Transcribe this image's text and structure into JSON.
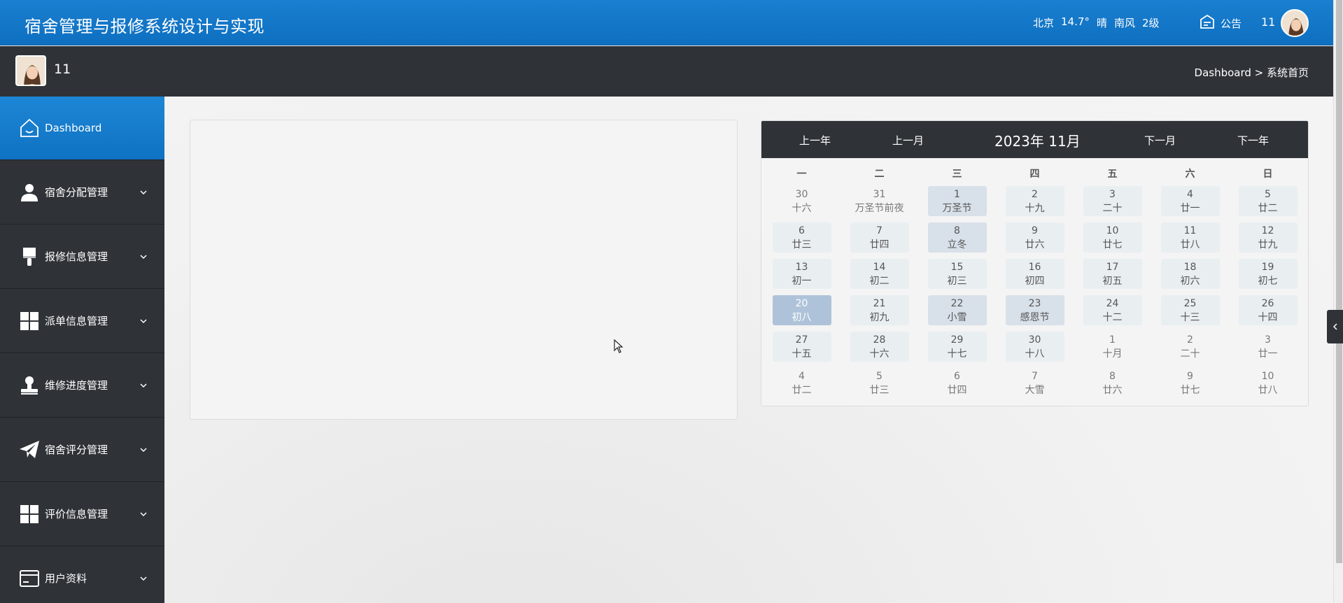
{
  "header": {
    "title": "宿舍管理与报修系统设计与实现",
    "weather": [
      "北京",
      "14.7°",
      "晴",
      "南风",
      "2级"
    ],
    "notice_label": "公告",
    "user_id": "11"
  },
  "subheader": {
    "user_name": "11",
    "breadcrumb": "Dashboard > 系统首页"
  },
  "sidebar": {
    "items": [
      {
        "label": "Dashboard",
        "icon": "home-icon"
      },
      {
        "label": "宿舍分配管理",
        "icon": "user-icon"
      },
      {
        "label": "报修信息管理",
        "icon": "brush-icon"
      },
      {
        "label": "派单信息管理",
        "icon": "grid-icon"
      },
      {
        "label": "维修进度管理",
        "icon": "stamp-icon"
      },
      {
        "label": "宿舍评分管理",
        "icon": "paper-plane-icon"
      },
      {
        "label": "评价信息管理",
        "icon": "grid-icon"
      },
      {
        "label": "用户资料",
        "icon": "card-icon"
      }
    ]
  },
  "calendar": {
    "prev_year": "上一年",
    "prev_month": "上一月",
    "year_month": "2023年 11月",
    "next_month": "下一月",
    "next_year": "下一年",
    "weekdays": [
      "一",
      "二",
      "三",
      "四",
      "五",
      "六",
      "日"
    ],
    "days": [
      {
        "d": "30",
        "l": "十六",
        "type": "other"
      },
      {
        "d": "31",
        "l": "万圣节前夜",
        "type": "other"
      },
      {
        "d": "1",
        "l": "万圣节",
        "type": "hl"
      },
      {
        "d": "2",
        "l": "十九",
        "type": "cur"
      },
      {
        "d": "3",
        "l": "二十",
        "type": "cur"
      },
      {
        "d": "4",
        "l": "廿一",
        "type": "cur"
      },
      {
        "d": "5",
        "l": "廿二",
        "type": "cur"
      },
      {
        "d": "6",
        "l": "廿三",
        "type": "cur"
      },
      {
        "d": "7",
        "l": "廿四",
        "type": "cur"
      },
      {
        "d": "8",
        "l": "立冬",
        "type": "hl"
      },
      {
        "d": "9",
        "l": "廿六",
        "type": "cur"
      },
      {
        "d": "10",
        "l": "廿七",
        "type": "cur"
      },
      {
        "d": "11",
        "l": "廿八",
        "type": "cur"
      },
      {
        "d": "12",
        "l": "廿九",
        "type": "cur"
      },
      {
        "d": "13",
        "l": "初一",
        "type": "cur"
      },
      {
        "d": "14",
        "l": "初二",
        "type": "cur"
      },
      {
        "d": "15",
        "l": "初三",
        "type": "cur"
      },
      {
        "d": "16",
        "l": "初四",
        "type": "cur"
      },
      {
        "d": "17",
        "l": "初五",
        "type": "cur"
      },
      {
        "d": "18",
        "l": "初六",
        "type": "cur"
      },
      {
        "d": "19",
        "l": "初七",
        "type": "cur"
      },
      {
        "d": "20",
        "l": "初八",
        "type": "today"
      },
      {
        "d": "21",
        "l": "初九",
        "type": "cur"
      },
      {
        "d": "22",
        "l": "小雪",
        "type": "hl"
      },
      {
        "d": "23",
        "l": "感恩节",
        "type": "hl"
      },
      {
        "d": "24",
        "l": "十二",
        "type": "cur"
      },
      {
        "d": "25",
        "l": "十三",
        "type": "cur"
      },
      {
        "d": "26",
        "l": "十四",
        "type": "cur"
      },
      {
        "d": "27",
        "l": "十五",
        "type": "cur"
      },
      {
        "d": "28",
        "l": "十六",
        "type": "cur"
      },
      {
        "d": "29",
        "l": "十七",
        "type": "cur"
      },
      {
        "d": "30",
        "l": "十八",
        "type": "cur"
      },
      {
        "d": "1",
        "l": "十月",
        "type": "other"
      },
      {
        "d": "2",
        "l": "二十",
        "type": "other"
      },
      {
        "d": "3",
        "l": "廿一",
        "type": "other"
      },
      {
        "d": "4",
        "l": "廿二",
        "type": "other"
      },
      {
        "d": "5",
        "l": "廿三",
        "type": "other"
      },
      {
        "d": "6",
        "l": "廿四",
        "type": "other"
      },
      {
        "d": "7",
        "l": "大雪",
        "type": "other"
      },
      {
        "d": "8",
        "l": "廿六",
        "type": "other"
      },
      {
        "d": "9",
        "l": "廿七",
        "type": "other"
      },
      {
        "d": "10",
        "l": "廿八",
        "type": "other"
      }
    ]
  },
  "colors": {
    "header_blue": "#1a7fd0",
    "dark_bar": "#2f3338",
    "today_cell": "#aec3d9",
    "highlight_cell": "#d8e0e9"
  }
}
